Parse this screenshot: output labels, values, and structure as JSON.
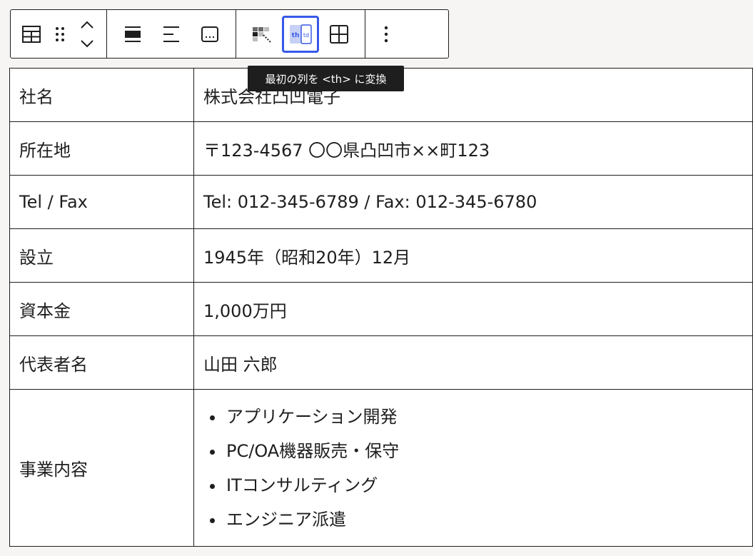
{
  "toolbar": {
    "groups": [
      {
        "name": "block-controls",
        "items": [
          "table-icon",
          "drag-handle-icon",
          "move-up-icon",
          "move-down-icon"
        ]
      },
      {
        "name": "alignment",
        "items": [
          "align-wide-icon",
          "align-left-icon",
          "caption-icon"
        ]
      },
      {
        "name": "table-tools",
        "items": [
          "table-style-icon",
          "first-column-header-icon",
          "table-grid-icon"
        ]
      },
      {
        "name": "options",
        "items": [
          "more-vertical-icon"
        ]
      }
    ],
    "th_label": "th",
    "td_label": "td",
    "active_color": "#3858e9"
  },
  "tooltip": {
    "text": "最初の列を <th> に変換"
  },
  "table": {
    "rows": [
      {
        "label": "社名",
        "value": "株式会社凸凹電子"
      },
      {
        "label": "所在地",
        "value": "〒123-4567 〇〇県凸凹市××町123"
      },
      {
        "label": "Tel / Fax",
        "value": "Tel: 012-345-6789 / Fax: 012-345-6780"
      },
      {
        "label": "設立",
        "value": "1945年（昭和20年）12月"
      },
      {
        "label": "資本金",
        "value": "1,000万円"
      },
      {
        "label": "代表者名",
        "value": "山田 六郎"
      }
    ],
    "business": {
      "label": "事業内容",
      "items": [
        "アプリケーション開発",
        "PC/OA機器販売・保守",
        "ITコンサルティング",
        "エンジニア派遣"
      ]
    }
  }
}
